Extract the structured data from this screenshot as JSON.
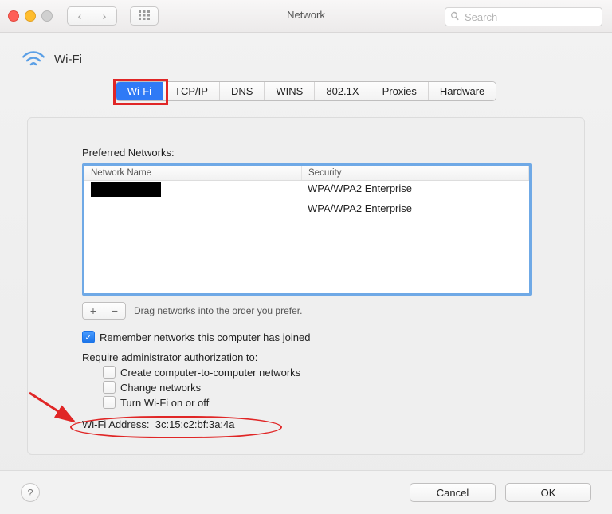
{
  "titlebar": {
    "title": "Network",
    "search_placeholder": "Search"
  },
  "header": {
    "interface_name": "Wi-Fi"
  },
  "tabs": [
    "Wi-Fi",
    "TCP/IP",
    "DNS",
    "WINS",
    "802.1X",
    "Proxies",
    "Hardware"
  ],
  "active_tab_index": 0,
  "preferred_networks": {
    "section_label": "Preferred Networks:",
    "columns": {
      "name": "Network Name",
      "security": "Security"
    },
    "rows": [
      {
        "name_redacted": true,
        "security": "WPA/WPA2 Enterprise"
      },
      {
        "name_redacted": false,
        "name": "",
        "security": "WPA/WPA2 Enterprise"
      }
    ],
    "drag_hint": "Drag networks into the order you prefer."
  },
  "options": {
    "remember_label": "Remember networks this computer has joined",
    "remember_checked": true,
    "require_admin_label": "Require administrator authorization to:",
    "admin_items": [
      {
        "label": "Create computer-to-computer networks",
        "checked": false
      },
      {
        "label": "Change networks",
        "checked": false
      },
      {
        "label": "Turn Wi-Fi on or off",
        "checked": false
      }
    ]
  },
  "wifi_address": {
    "label": "Wi-Fi Address:",
    "value": "3c:15:c2:bf:3a:4a"
  },
  "buttons": {
    "cancel": "Cancel",
    "ok": "OK"
  }
}
